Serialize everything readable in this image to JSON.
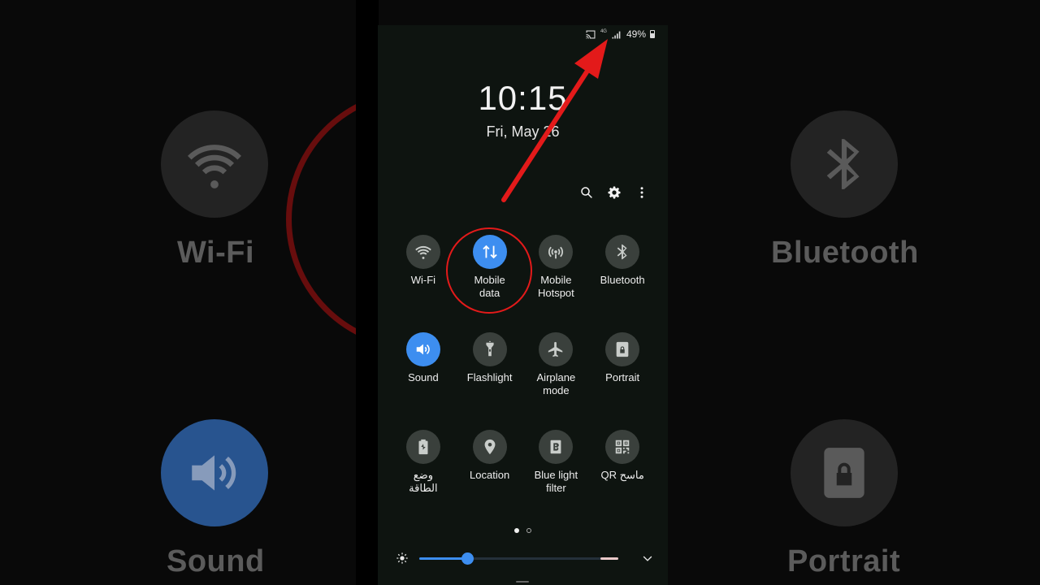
{
  "status_bar": {
    "network_type": "4G",
    "battery_percent": "49%",
    "battery_level": 0.49
  },
  "clock": {
    "time": "10:15",
    "date": "Fri, May 26"
  },
  "toolbar": {
    "search_icon": "search-icon",
    "settings_icon": "gear-icon",
    "more_icon": "more-vertical-icon"
  },
  "quick_settings": [
    {
      "label": "Wi-Fi",
      "icon": "wifi-icon",
      "active": false
    },
    {
      "label": "Mobile\ndata",
      "icon": "mobile-data-icon",
      "active": true
    },
    {
      "label": "Mobile\nHotspot",
      "icon": "hotspot-icon",
      "active": false
    },
    {
      "label": "Bluetooth",
      "icon": "bluetooth-icon",
      "active": false
    },
    {
      "label": "Sound",
      "icon": "sound-icon",
      "active": true
    },
    {
      "label": "Flashlight",
      "icon": "flashlight-icon",
      "active": false
    },
    {
      "label": "Airplane\nmode",
      "icon": "airplane-icon",
      "active": false
    },
    {
      "label": "Portrait",
      "icon": "portrait-lock-icon",
      "active": false
    },
    {
      "label": "وضع\nالطاقة",
      "icon": "power-mode-icon",
      "active": false
    },
    {
      "label": "Location",
      "icon": "location-icon",
      "active": false
    },
    {
      "label": "Blue light\nfilter",
      "icon": "blue-light-icon",
      "active": false
    },
    {
      "label": "QR ماسح",
      "icon": "qr-icon",
      "active": false
    }
  ],
  "pagination": {
    "current": 1,
    "total": 2
  },
  "brightness": {
    "level": 0.24
  },
  "colors": {
    "accent": "#3d8ef0",
    "annotation": "#e31a1a"
  },
  "background": {
    "labels": {
      "wifi": "Wi-Fi",
      "bluetooth": "Bluetooth",
      "sound": "Sound",
      "portrait": "Portrait"
    }
  }
}
